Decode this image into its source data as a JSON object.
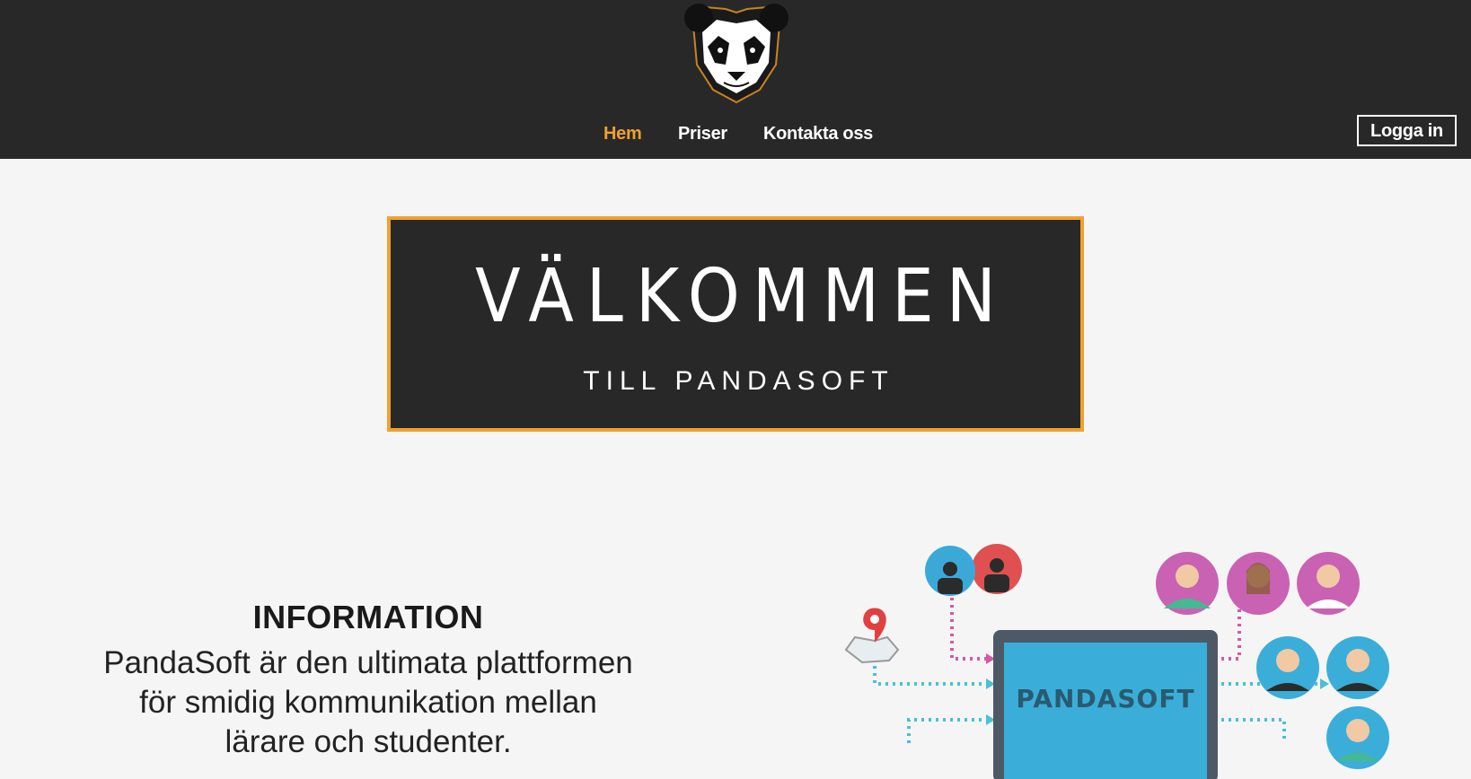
{
  "header": {
    "logo_icon": "panda-head-icon",
    "nav": [
      {
        "label": "Hem",
        "active": true
      },
      {
        "label": "Priser",
        "active": false
      },
      {
        "label": "Kontakta oss",
        "active": false
      }
    ],
    "login_label": "Logga in"
  },
  "hero": {
    "title": "VÄLKOMMEN",
    "subtitle": "TILL PANDASOFT"
  },
  "info": {
    "heading": "INFORMATION",
    "lines": [
      "PandaSoft är den ultimata plattformen",
      "för smidig kommunikation mellan",
      "lärare och studenter."
    ]
  },
  "illustration": {
    "screen_label": "PANDASOFT"
  },
  "colors": {
    "header_bg": "#282828",
    "accent": "#f0a030",
    "page_bg": "#f5f5f5"
  }
}
